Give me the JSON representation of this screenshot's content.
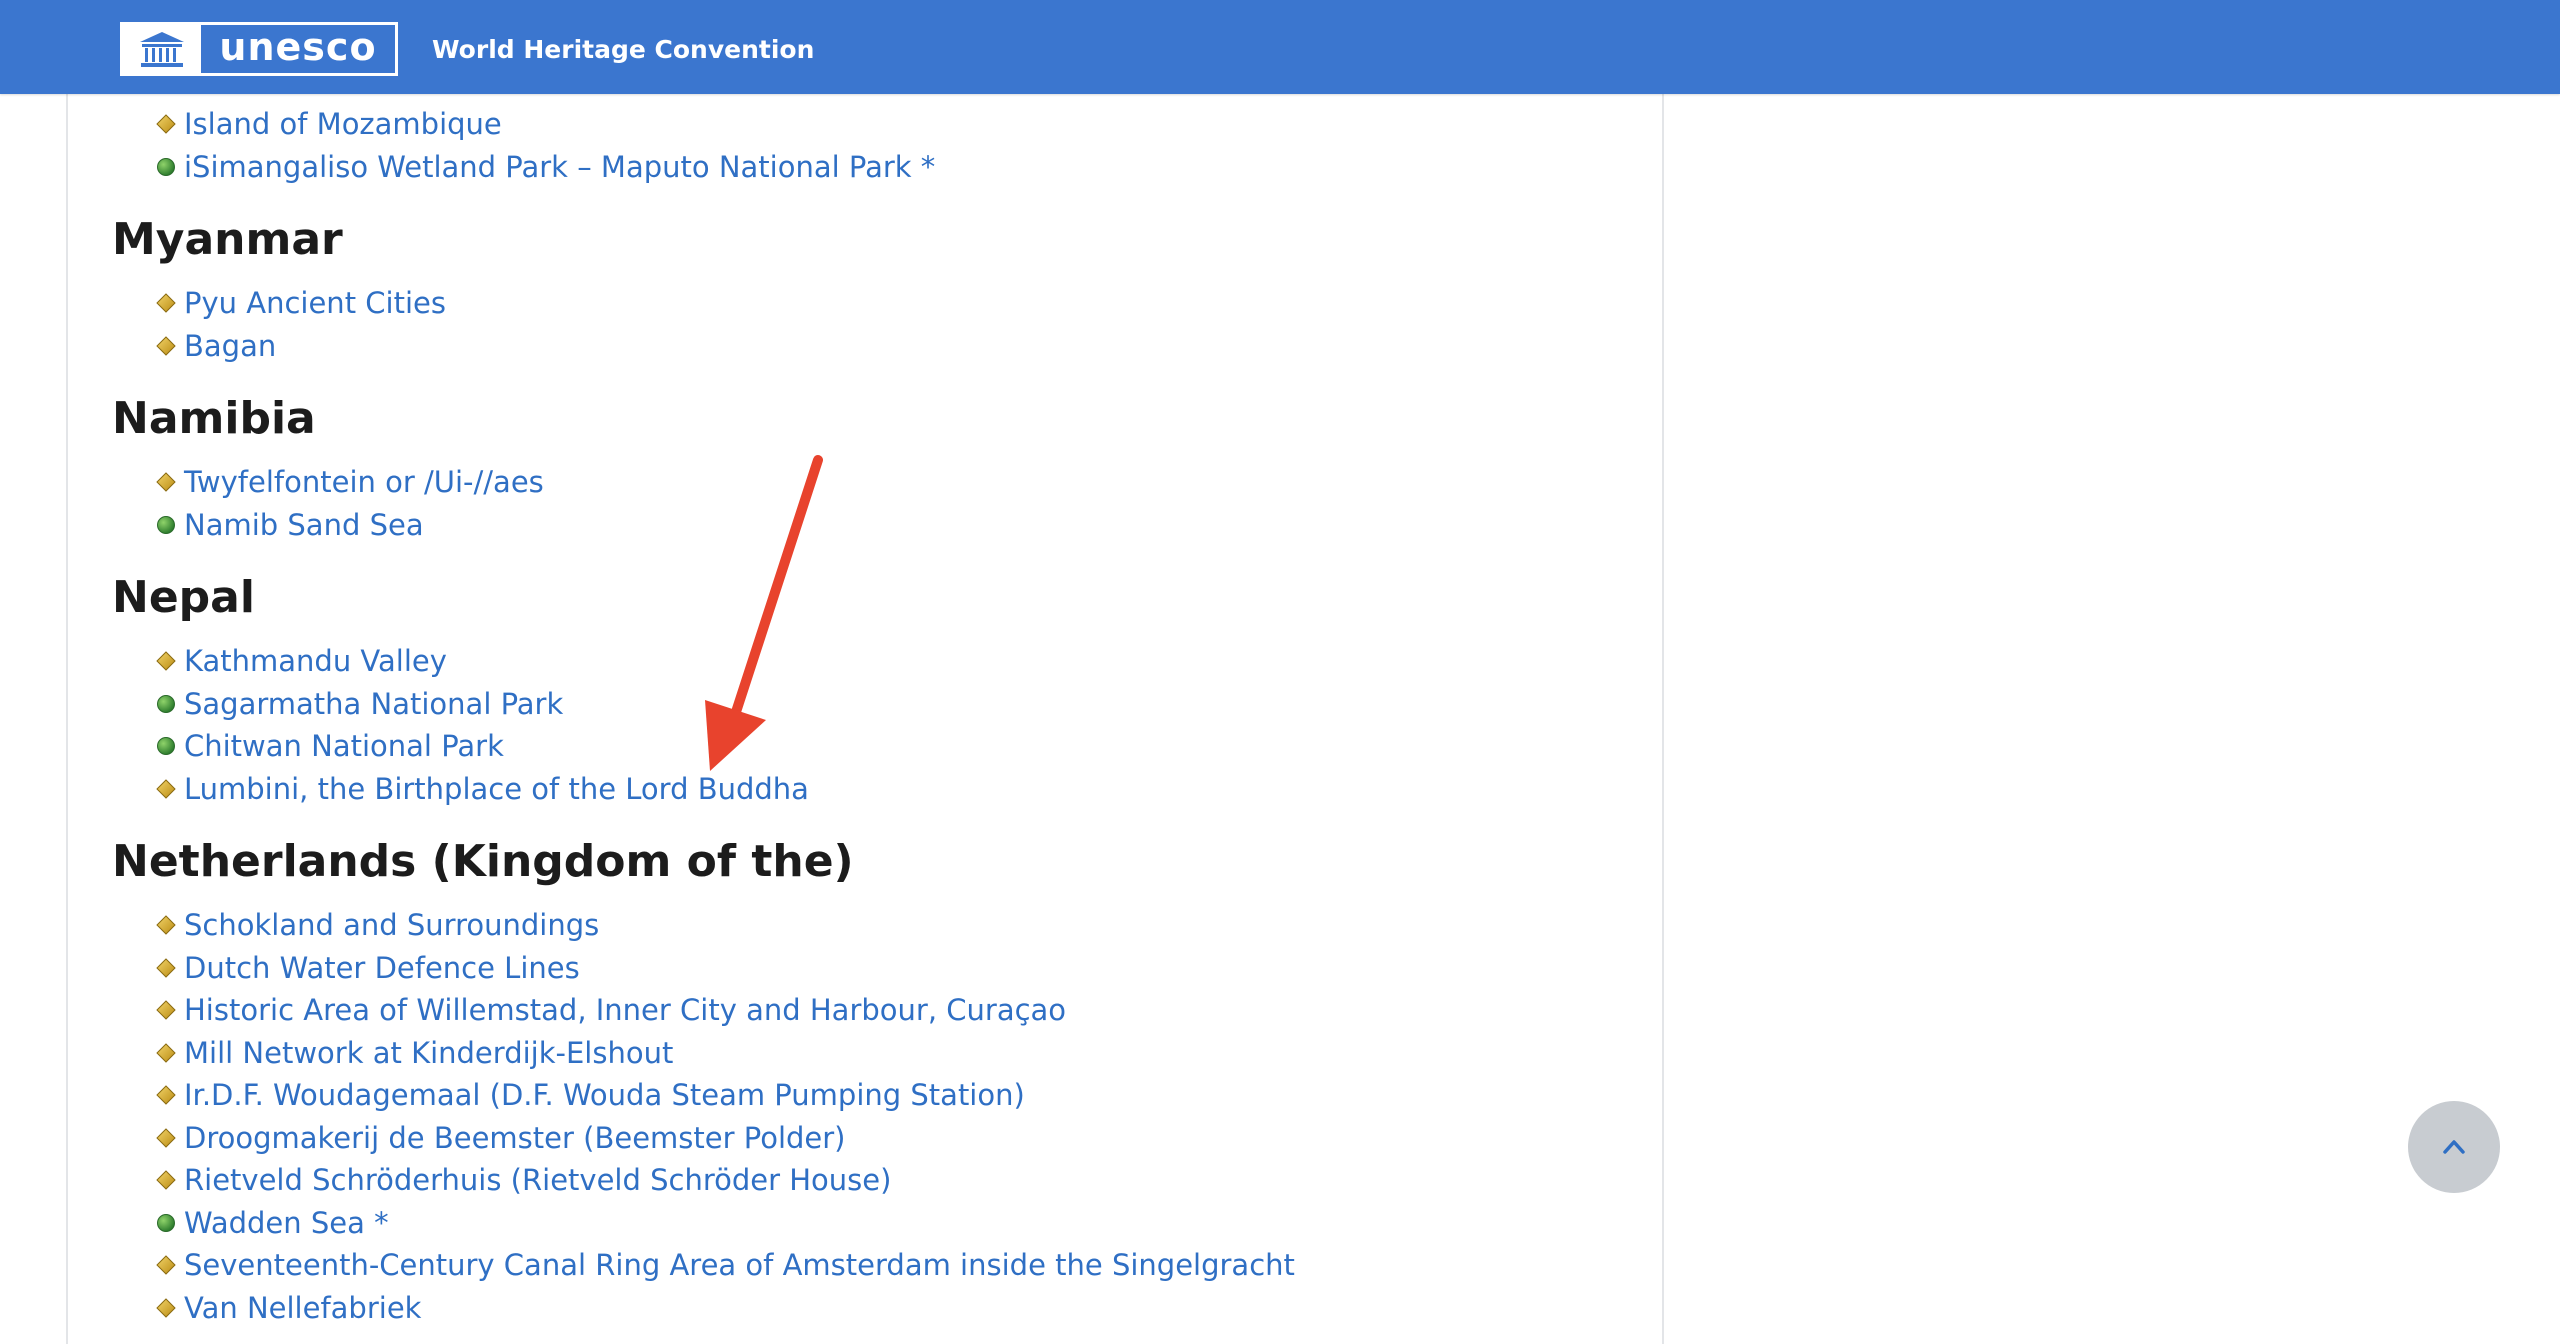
{
  "header": {
    "logo_text": "unesco",
    "site_title": "World Heritage Convention",
    "bar_color": "#3b76cf"
  },
  "colors": {
    "link": "#2f6fc4",
    "cultural_icon": "#d4a62a",
    "natural_icon": "#3f9a3f",
    "annotation_arrow": "#e8432d"
  },
  "list": {
    "continued_items": [
      {
        "name": "Island of Mozambique",
        "type": "cultural"
      },
      {
        "name": "iSimangaliso Wetland Park – Maputo National Park *",
        "type": "natural"
      }
    ],
    "countries": [
      {
        "name": "Myanmar",
        "sites": [
          {
            "name": "Pyu Ancient Cities",
            "type": "cultural"
          },
          {
            "name": "Bagan",
            "type": "cultural"
          }
        ]
      },
      {
        "name": "Namibia",
        "sites": [
          {
            "name": "Twyfelfontein or /Ui-//aes",
            "type": "cultural"
          },
          {
            "name": "Namib Sand Sea",
            "type": "natural"
          }
        ]
      },
      {
        "name": "Nepal",
        "sites": [
          {
            "name": "Kathmandu Valley",
            "type": "cultural"
          },
          {
            "name": "Sagarmatha National Park",
            "type": "natural"
          },
          {
            "name": "Chitwan National Park",
            "type": "natural"
          },
          {
            "name": "Lumbini, the Birthplace of the Lord Buddha",
            "type": "cultural"
          }
        ]
      },
      {
        "name": "Netherlands (Kingdom of the)",
        "sites": [
          {
            "name": "Schokland and Surroundings",
            "type": "cultural"
          },
          {
            "name": "Dutch Water Defence Lines",
            "type": "cultural"
          },
          {
            "name": "Historic Area of Willemstad, Inner City and Harbour, Curaçao",
            "type": "cultural"
          },
          {
            "name": "Mill Network at Kinderdijk-Elshout",
            "type": "cultural"
          },
          {
            "name": "Ir.D.F. Woudagemaal (D.F. Wouda Steam Pumping Station)",
            "type": "cultural"
          },
          {
            "name": "Droogmakerij de Beemster (Beemster Polder)",
            "type": "cultural"
          },
          {
            "name": "Rietveld Schröderhuis (Rietveld Schröder House)",
            "type": "cultural"
          },
          {
            "name": "Wadden Sea *",
            "type": "natural"
          },
          {
            "name": "Seventeenth-Century Canal Ring Area of Amsterdam inside the Singelgracht",
            "type": "cultural"
          },
          {
            "name": "Van Nellefabriek",
            "type": "cultural"
          }
        ]
      }
    ]
  },
  "scroll_top": {
    "icon": "chevron-up-icon"
  }
}
